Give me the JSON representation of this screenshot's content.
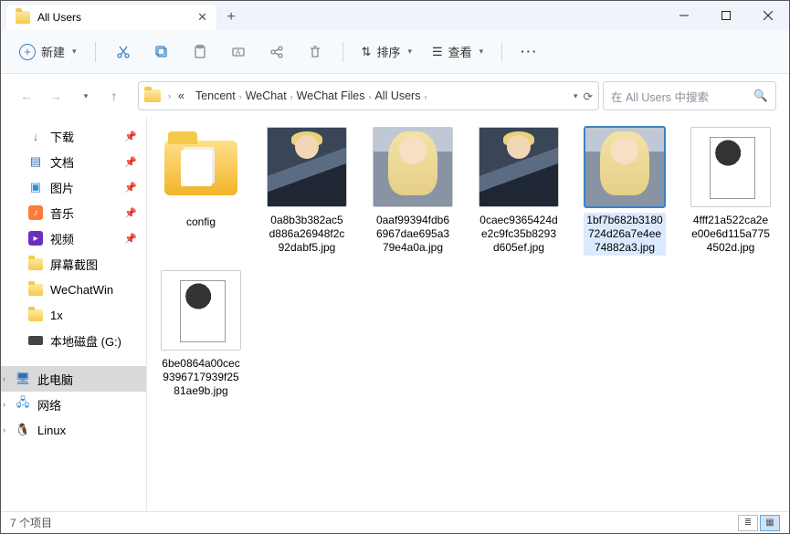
{
  "window": {
    "title": "All Users"
  },
  "toolbar": {
    "new_label": "新建",
    "sort_label": "排序",
    "view_label": "查看"
  },
  "breadcrumbs": [
    "Tencent",
    "WeChat",
    "WeChat Files",
    "All Users"
  ],
  "search": {
    "placeholder": "在 All Users 中搜索"
  },
  "sidebar": {
    "quick": [
      {
        "label": "下载",
        "icon": "download",
        "pinned": true
      },
      {
        "label": "文档",
        "icon": "document",
        "pinned": true
      },
      {
        "label": "图片",
        "icon": "pictures",
        "pinned": true
      },
      {
        "label": "音乐",
        "icon": "music",
        "pinned": true
      },
      {
        "label": "视频",
        "icon": "video",
        "pinned": true
      },
      {
        "label": "屏幕截图",
        "icon": "folder",
        "pinned": false
      },
      {
        "label": "WeChatWin",
        "icon": "folder",
        "pinned": false
      },
      {
        "label": "1x",
        "icon": "folder",
        "pinned": false
      },
      {
        "label": "本地磁盘 (G:)",
        "icon": "drive",
        "pinned": false
      }
    ],
    "groups": [
      {
        "label": "此电脑",
        "icon": "pc",
        "selected": true
      },
      {
        "label": "网络",
        "icon": "network",
        "selected": false
      },
      {
        "label": "Linux",
        "icon": "linux",
        "selected": false
      }
    ]
  },
  "items": [
    {
      "name": "config",
      "type": "folder"
    },
    {
      "name": "0a8b3b382ac5d886a26948f2c92dabf5.jpg",
      "type": "image",
      "art": "male"
    },
    {
      "name": "0aaf99394fdb66967dae695a379e4a0a.jpg",
      "type": "image",
      "art": "female"
    },
    {
      "name": "0caec9365424de2c9fc35b8293d605ef.jpg",
      "type": "image",
      "art": "male"
    },
    {
      "name": "1bf7b682b3180724d26a7e4ee74882a3.jpg",
      "type": "image",
      "art": "female",
      "selected": true
    },
    {
      "name": "4fff21a522ca2ee00e6d115a7754502d.jpg",
      "type": "image",
      "art": "bw"
    },
    {
      "name": "6be0864a00cec9396717939f2581ae9b.jpg",
      "type": "image",
      "art": "bw"
    }
  ],
  "status": {
    "count_label": "7 个项目"
  }
}
